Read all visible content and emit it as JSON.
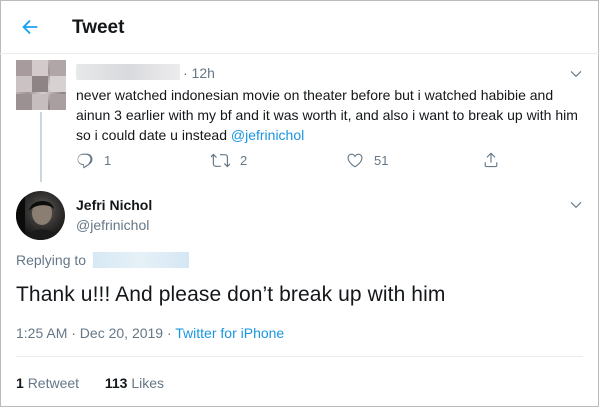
{
  "header": {
    "title": "Tweet",
    "accent": "#1da1f2"
  },
  "parent_tweet": {
    "time": "· 12h",
    "text_before_mention": "never watched indonesian movie on theater before but i watched habibie and ainun 3 earlier with my bf and it was worth it, and also i want to break up with him so i could date u instead ",
    "mention": "@jefrinichol",
    "actions": {
      "reply_count": "1",
      "retweet_count": "2",
      "like_count": "51"
    },
    "icons": [
      "reply-icon",
      "retweet-icon",
      "like-icon",
      "share-icon"
    ]
  },
  "reply_tweet": {
    "name": "Jefri Nichol",
    "handle": "@jefrinichol",
    "replying_to_label": "Replying to",
    "text": "Thank u!!! And please don’t break up with him",
    "time": "1:25 AM · Dec 20, 2019 · ",
    "client": "Twitter for iPhone",
    "stats": {
      "retweet_count": "1",
      "retweet_label": "Retweet",
      "like_count": "113",
      "like_label": "Likes"
    }
  },
  "colors": {
    "text_primary": "#14171a",
    "text_secondary": "#657786",
    "link": "#1b95e0",
    "divider": "#e6ecf0"
  }
}
